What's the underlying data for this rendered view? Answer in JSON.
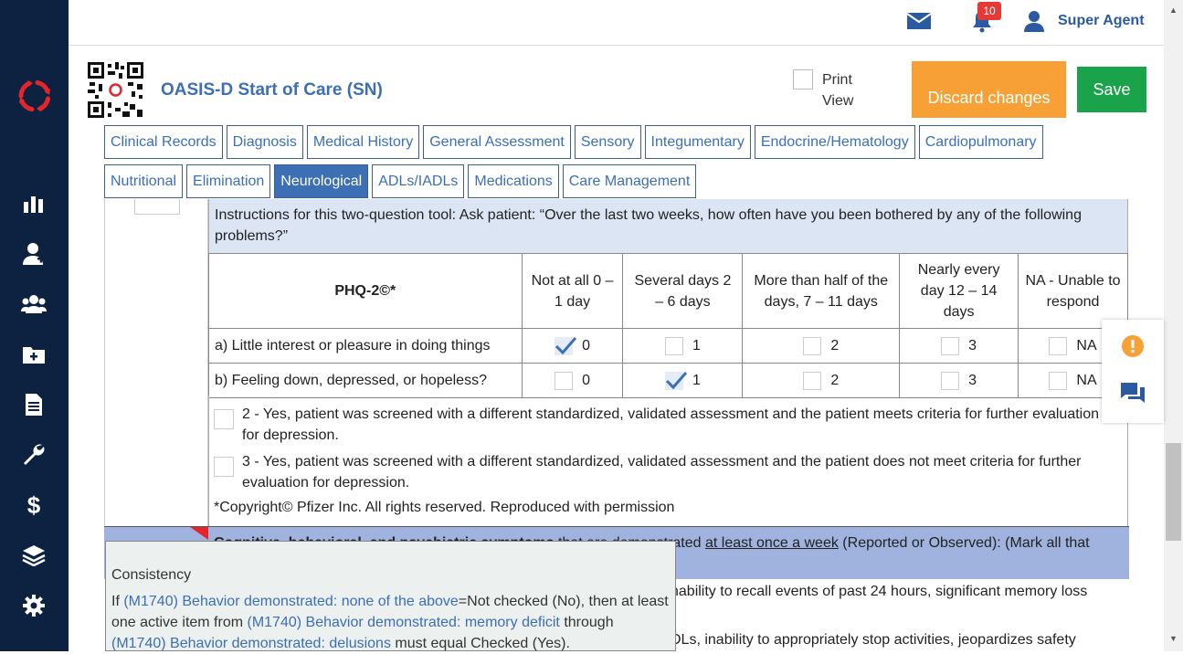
{
  "topbar": {
    "badge_count": "10",
    "user_name": "Super Agent"
  },
  "header": {
    "title": "OASIS-D Start of Care (SN)",
    "print_view_label": "Print View",
    "discard_label": "Discard changes",
    "save_label": "Save"
  },
  "tabs_row1": [
    "Clinical Records",
    "Diagnosis",
    "Medical History",
    "General Assessment",
    "Sensory",
    "Integumentary",
    "Endocrine/Hematology",
    "Cardiopulmonary"
  ],
  "tabs_row2": [
    "Nutritional",
    "Elimination",
    "Neurological",
    "ADLs/IADLs",
    "Medications",
    "Care Management"
  ],
  "active_tab": "Neurological",
  "instructions": "Instructions for this two-question tool: Ask patient: “Over the last two weeks, how often have you been bothered by any of the following problems?”",
  "phq": {
    "title": "PHQ-2©*",
    "columns": [
      "Not at all 0 – 1 day",
      "Several days 2 – 6 days",
      "More than half of the days, 7 – 11 days",
      "Nearly every day 12 – 14 days",
      "NA - Unable to respond"
    ],
    "rows": [
      {
        "label": "a) Little interest or pleasure in doing things",
        "values": [
          "0",
          "1",
          "2",
          "3",
          "NA"
        ],
        "checked_index": 0
      },
      {
        "label": "b) Feeling down, depressed, or hopeless?",
        "values": [
          "0",
          "1",
          "2",
          "3",
          "NA"
        ],
        "checked_index": 1
      }
    ]
  },
  "options": [
    "2 - Yes, patient was screened with a different standardized, validated assessment and the patient meets criteria for further evaluation for depression.",
    "3 - Yes, patient was screened with a different standardized, validated assessment and the patient does not meet criteria for further evaluation for depression."
  ],
  "copyright": "*Copyright© Pfizer Inc. All rights reserved. Reproduced with permission",
  "m1740": {
    "bold": "Cognitive, behavioral, and psychiatric symptoms",
    "mid": " that are demonstrated ",
    "underlined": "at least once a week",
    "tail": " (Reported or Observed): (Mark all that"
  },
  "below_text_1": "nability to recall events of past 24 hours, significant memory loss",
  "below_text_2": "DLs, inability to appropriately stop activities, jeopardizes safety",
  "tooltip": {
    "title": "Consistency",
    "p1": "If ",
    "l1": "(M1740) Behavior demonstrated: none of the above",
    "p2": "=Not checked (No), then at least one active item from ",
    "l2": "(M1740) Behavior demonstrated: memory deficit",
    "p3": " through ",
    "l3": "(M1740) Behavior demonstrated: delusions",
    "p4": " must equal Checked (Yes)."
  },
  "colors": {
    "sidebar": "#0d2240",
    "accent": "#3c6fb3",
    "discard": "#f7a035",
    "save": "#1aa34a",
    "warning": "#f7a035"
  }
}
